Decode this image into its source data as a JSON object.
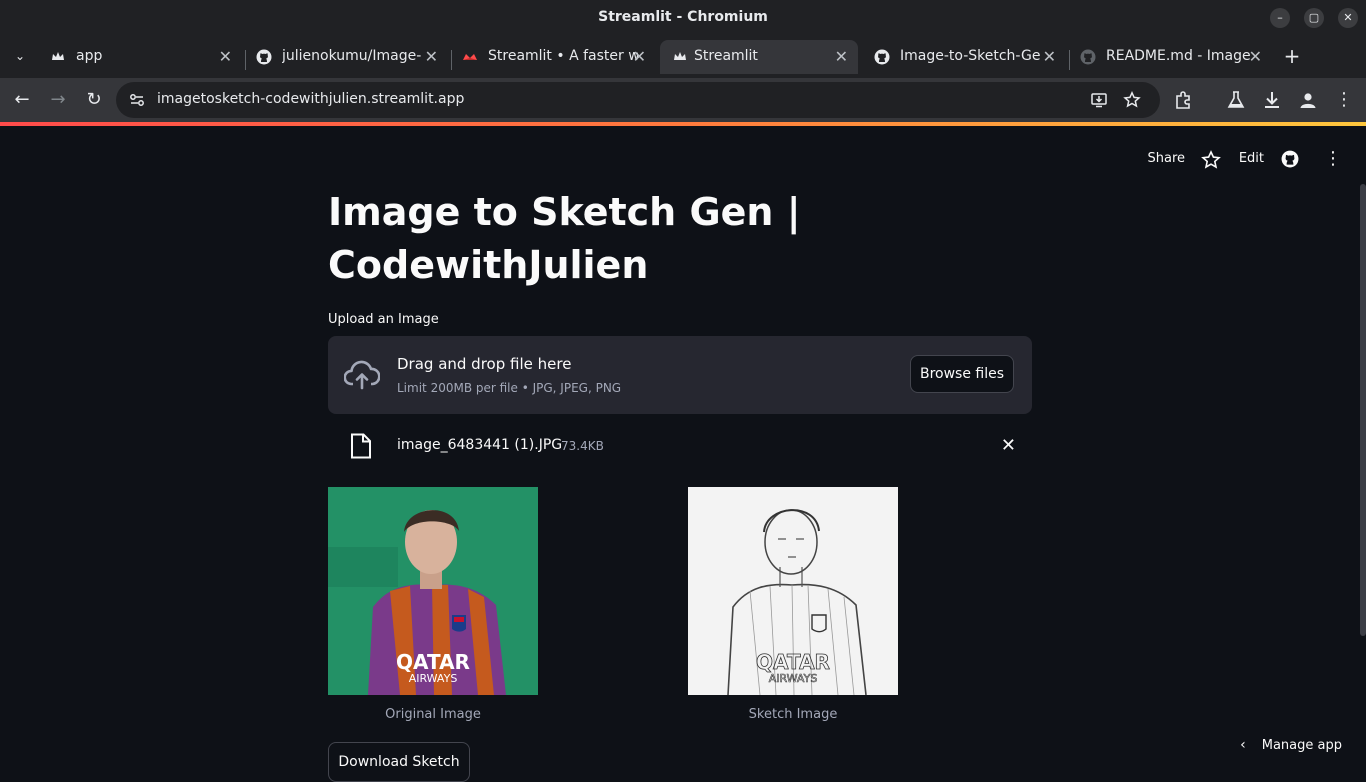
{
  "window": {
    "title": "Streamlit - Chromium",
    "minimize": "–",
    "maximize": "▢",
    "close": "✕"
  },
  "tabs": [
    {
      "label": "app",
      "favicon": "streamlit-crown"
    },
    {
      "label": "julienokumu/Image-",
      "favicon": "github"
    },
    {
      "label": "Streamlit • A faster w",
      "favicon": "streamlit-logo"
    },
    {
      "label": "Streamlit",
      "favicon": "streamlit-crown",
      "active": true
    },
    {
      "label": "Image-to-Sketch-Ge",
      "favicon": "github"
    },
    {
      "label": "README.md - Image",
      "favicon": "github"
    }
  ],
  "toolbar": {
    "url": "imagetosketch-codewithjulien.streamlit.app"
  },
  "app_header": {
    "share": "Share",
    "edit": "Edit"
  },
  "main": {
    "title_line1": "Image to Sketch Gen |",
    "title_line2": "CodewithJulien",
    "uploader_label": "Upload an Image",
    "drop_title": "Drag and drop file here",
    "drop_hint": "Limit 200MB per file • JPG, JPEG, PNG",
    "browse_label": "Browse files",
    "file_name": "image_6483441 (1).JPG",
    "file_size": "73.4KB",
    "original_caption": "Original Image",
    "sketch_caption": "Sketch Image",
    "download_label": "Download Sketch"
  },
  "footer": {
    "manage_app": "Manage app"
  },
  "colors": {
    "background": "#0e1117",
    "surface": "#262730",
    "accent": "#ff4b4b",
    "muted_text": "#a3a8b8"
  }
}
